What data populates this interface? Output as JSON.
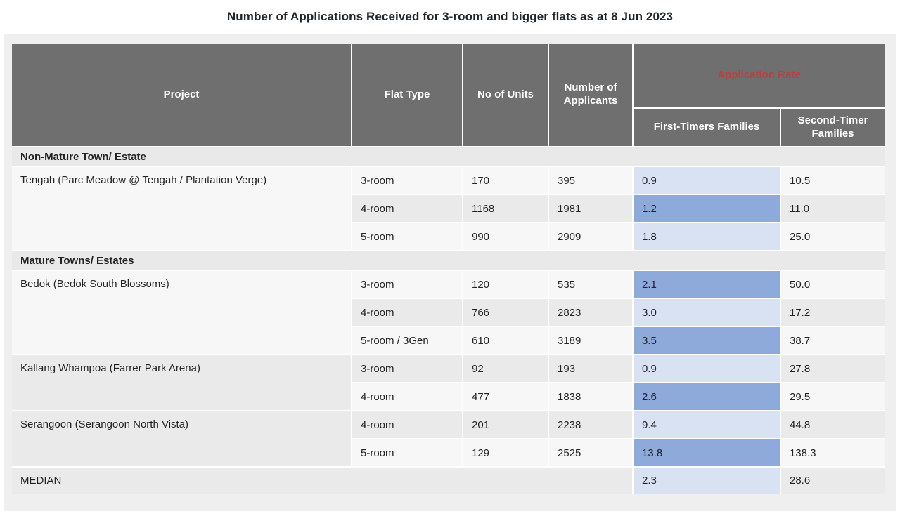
{
  "title": "Number of Applications Received for 3-room and bigger flats as at 8 Jun 2023",
  "colors": {
    "page-bg": "#ffffff",
    "panel-bg": "#efefef",
    "header-bg": "#6f6f6f",
    "header-text": "#ffffff",
    "accent-red": "#b84043",
    "section-bg": "#e9e9e9",
    "row-light": "#f7f7f7",
    "row-gray": "#eaeaea",
    "rate-light": "#d9e2f3",
    "rate-dark": "#8eaadb",
    "text": "#242424",
    "title-text": "#20262e"
  },
  "table": {
    "header": {
      "project": "Project",
      "flat_type": "Flat Type",
      "units": "No of Units",
      "applicants": "Number of Applicants",
      "application_rate": "Application Rate",
      "first_timers": "First-Timers Families",
      "second_timers": "Second-Timer Families"
    },
    "sections": [
      {
        "label": "Non-Mature Town/ Estate",
        "projects": [
          {
            "name": "Tengah (Parc Meadow @ Tengah / Plantation Verge)",
            "rows": [
              {
                "flat_type": "3-room",
                "units": "170",
                "applicants": "395",
                "first_timer_rate": "0.9",
                "second_timer_rate": "10.5"
              },
              {
                "flat_type": "4-room",
                "units": "1168",
                "applicants": "1981",
                "first_timer_rate": "1.2",
                "second_timer_rate": "11.0"
              },
              {
                "flat_type": "5-room",
                "units": "990",
                "applicants": "2909",
                "first_timer_rate": "1.8",
                "second_timer_rate": "25.0"
              }
            ]
          }
        ]
      },
      {
        "label": "Mature Towns/ Estates",
        "projects": [
          {
            "name": "Bedok (Bedok South Blossoms)",
            "rows": [
              {
                "flat_type": "3-room",
                "units": "120",
                "applicants": "535",
                "first_timer_rate": "2.1",
                "second_timer_rate": "50.0"
              },
              {
                "flat_type": "4-room",
                "units": "766",
                "applicants": "2823",
                "first_timer_rate": "3.0",
                "second_timer_rate": "17.2"
              },
              {
                "flat_type": "5-room / 3Gen",
                "units": "610",
                "applicants": "3189",
                "first_timer_rate": "3.5",
                "second_timer_rate": "38.7"
              }
            ]
          },
          {
            "name": "Kallang Whampoa (Farrer Park Arena)",
            "rows": [
              {
                "flat_type": "3-room",
                "units": "92",
                "applicants": "193",
                "first_timer_rate": "0.9",
                "second_timer_rate": "27.8"
              },
              {
                "flat_type": "4-room",
                "units": "477",
                "applicants": "1838",
                "first_timer_rate": "2.6",
                "second_timer_rate": "29.5"
              }
            ]
          },
          {
            "name": "Serangoon (Serangoon North Vista)",
            "rows": [
              {
                "flat_type": "4-room",
                "units": "201",
                "applicants": "2238",
                "first_timer_rate": "9.4",
                "second_timer_rate": "44.8"
              },
              {
                "flat_type": "5-room",
                "units": "129",
                "applicants": "2525",
                "first_timer_rate": "13.8",
                "second_timer_rate": "138.3"
              }
            ]
          }
        ]
      }
    ],
    "median": {
      "label": "MEDIAN",
      "first_timer_rate": "2.3",
      "second_timer_rate": "28.6"
    }
  }
}
